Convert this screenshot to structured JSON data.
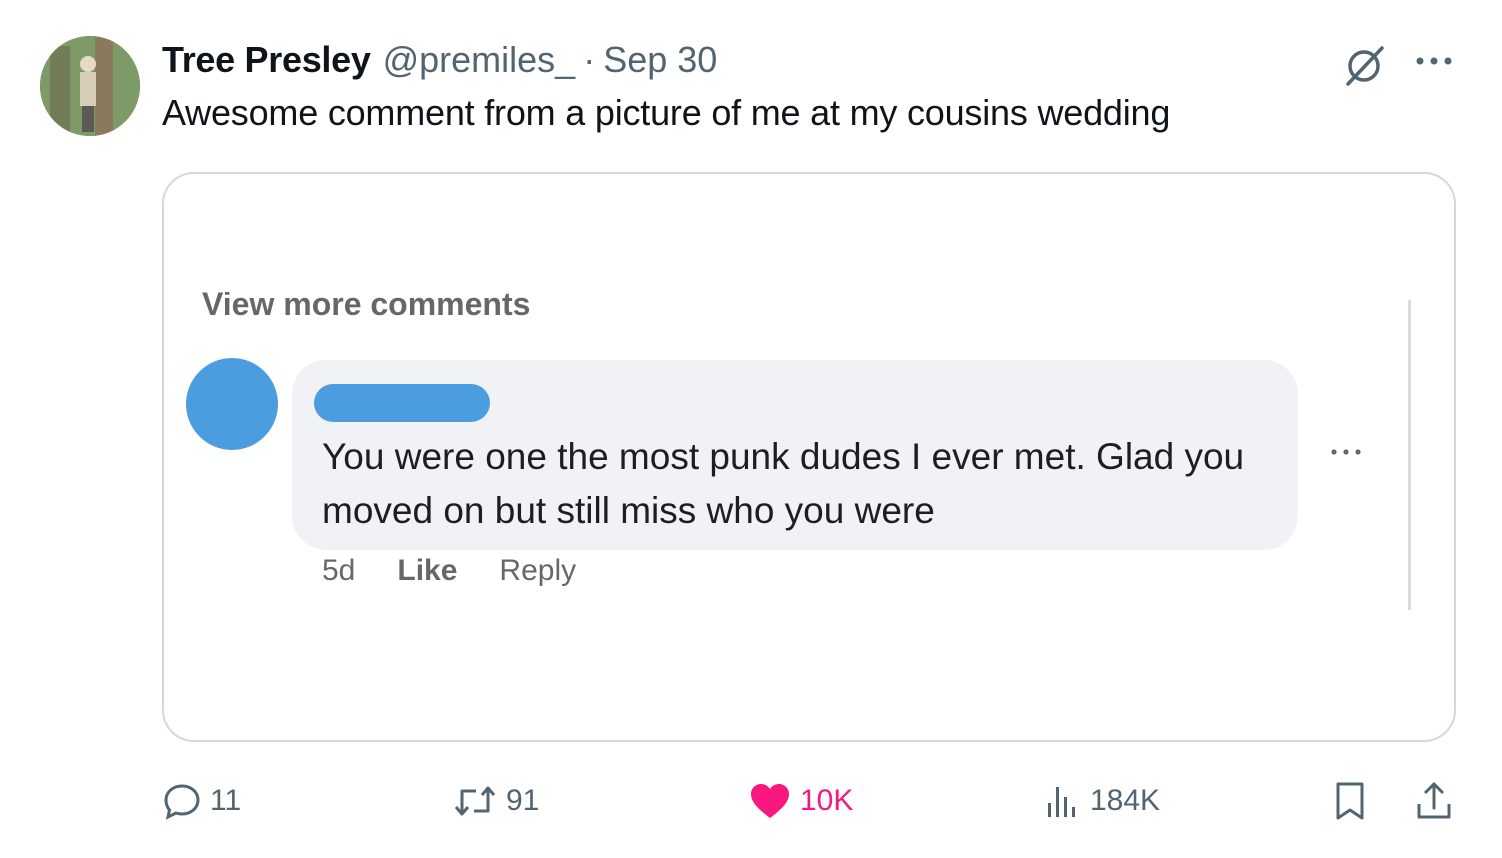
{
  "tweet": {
    "display_name": "Tree Presley",
    "handle": "@premiles_",
    "separator": "·",
    "date": "Sep 30",
    "text": "Awesome comment from a picture of me at my cousins wedding"
  },
  "media": {
    "view_more": "View more comments",
    "comment_text": "You were one the most punk dudes I ever met. Glad you moved on but still miss who you were",
    "comment_age": "5d",
    "like_label": "Like",
    "reply_label": "Reply",
    "avatar_color": "#4c9de0",
    "bubble_color": "#f0f2f5"
  },
  "actions": {
    "replies": "11",
    "reposts": "91",
    "likes": "10K",
    "views": "184K"
  },
  "colors": {
    "like_pink": "#f91880",
    "secondary_text": "#536471",
    "border": "#cfd9de"
  },
  "icons": [
    "grok-icon",
    "more-icon",
    "reply-icon",
    "repost-icon",
    "heart-icon",
    "views-icon",
    "bookmark-icon",
    "share-icon"
  ]
}
